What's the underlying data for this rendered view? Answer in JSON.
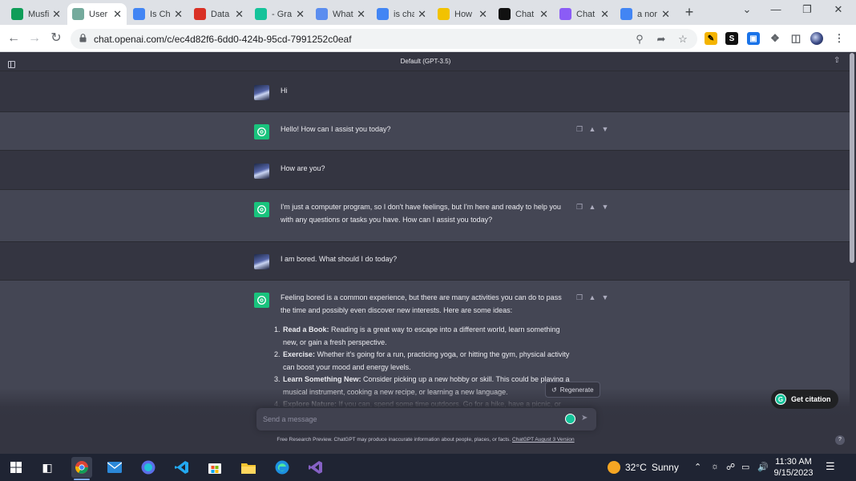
{
  "browser": {
    "tabs": [
      {
        "label": "Musfi",
        "icon": "sheets-icon",
        "color": "#0f9d58"
      },
      {
        "label": "User",
        "icon": "chatgpt-icon",
        "color": "#74aa9c",
        "active": true
      },
      {
        "label": "Is Ch",
        "icon": "docs-icon",
        "color": "#4285f4"
      },
      {
        "label": "Data",
        "icon": "camera-icon",
        "color": "#d93025"
      },
      {
        "label": "- Gra",
        "icon": "grammarly-icon",
        "color": "#15c39a"
      },
      {
        "label": "What",
        "icon": "quillbot-icon",
        "color": "#5b8def"
      },
      {
        "label": "is cha",
        "icon": "google-icon",
        "color": "#4285f4"
      },
      {
        "label": "How",
        "icon": "plagiarism-icon",
        "color": "#f2c200"
      },
      {
        "label": "Chat",
        "icon": "zb-icon",
        "color": "#111111"
      },
      {
        "label": "Chat",
        "icon": "claude-icon",
        "color": "#8b5cf6"
      },
      {
        "label": "a nor",
        "icon": "google-icon",
        "color": "#4285f4"
      }
    ],
    "url": "chat.openai.com/c/ec4d82f6-6dd0-424b-95cd-7991252c0eaf"
  },
  "page": {
    "model_title": "Default (GPT-3.5)",
    "messages": [
      {
        "role": "user",
        "text": "Hi"
      },
      {
        "role": "assistant",
        "text": "Hello! How can I assist you today?"
      },
      {
        "role": "user",
        "text": "How are you?"
      },
      {
        "role": "assistant",
        "text": "I'm just a computer program, so I don't have feelings, but I'm here and ready to help you with any questions or tasks you have. How can I assist you today?"
      },
      {
        "role": "user",
        "text": "I am bored. What should I do today?"
      },
      {
        "role": "assistant",
        "text": "Feeling bored is a common experience, but there are many activities you can do to pass the time and possibly even discover new interests. Here are some ideas:"
      }
    ],
    "ideas": [
      {
        "num": "1.",
        "title": "Read a Book:",
        "text": "Reading is a great way to escape into a different world, learn something new, or gain a fresh perspective."
      },
      {
        "num": "2.",
        "title": "Exercise:",
        "text": "Whether it's going for a run, practicing yoga, or hitting the gym, physical activity can boost your mood and energy levels."
      },
      {
        "num": "3.",
        "title": "Learn Something New:",
        "text": "Consider picking up a new hobby or skill. This could be playing a musical instrument, cooking a new recipe, or learning a new language."
      },
      {
        "num": "4.",
        "title": "Explore Nature:",
        "text": "If you can, spend some time outdoors. Go for a hike, have a picnic, or simply"
      }
    ],
    "regenerate_label": "Regenerate",
    "composer_placeholder": "Send a message",
    "disclaimer": "Free Research Preview. ChatGPT may produce inaccurate information about people, places, or facts.",
    "disclaimer_link": "ChatGPT August 3 Version",
    "citation_label": "Get citation",
    "help_label": "?"
  },
  "taskbar": {
    "weather_temp": "32°C",
    "weather_desc": "Sunny",
    "time": "11:30 AM",
    "date": "9/15/2023"
  }
}
